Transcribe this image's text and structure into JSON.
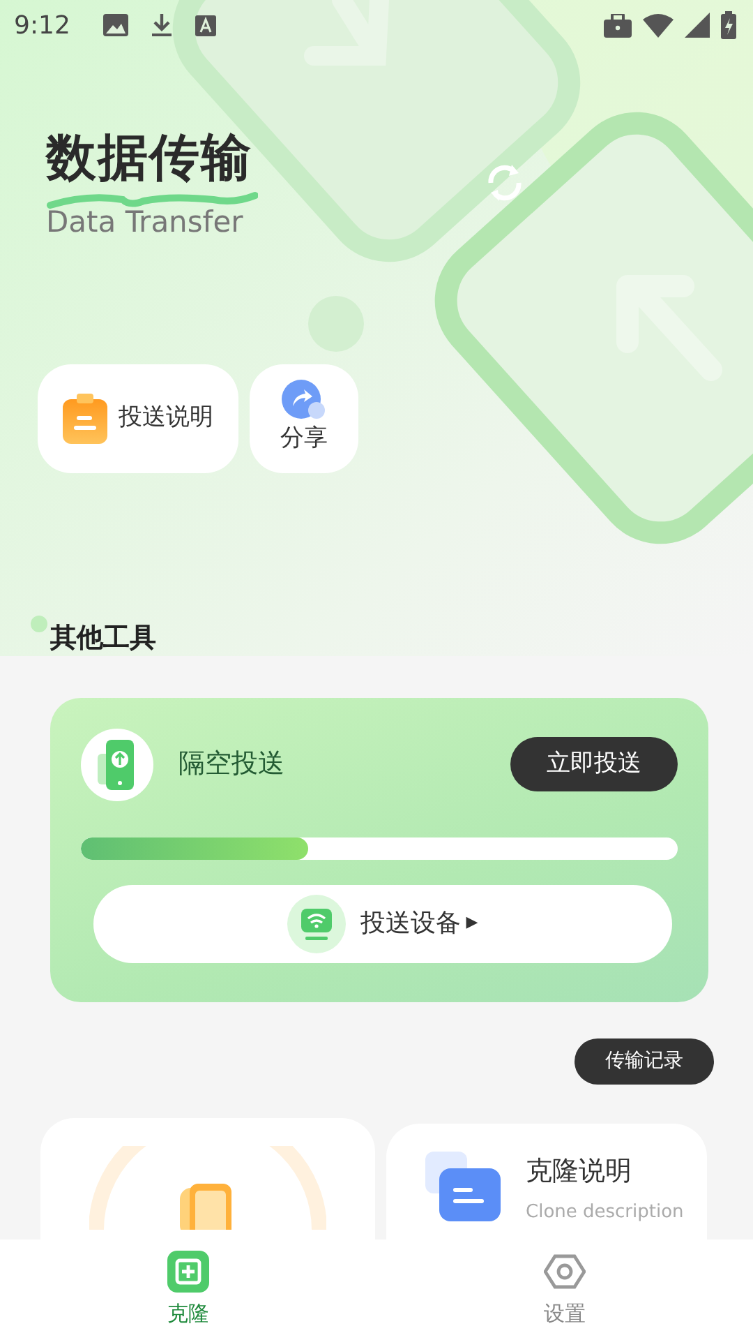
{
  "status_bar": {
    "time": "9:12"
  },
  "header": {
    "title": "数据传输",
    "subtitle": "Data Transfer"
  },
  "quick_actions": [
    {
      "label": "投送说明",
      "kind": "row"
    },
    {
      "label": "分享",
      "kind": "stacked"
    }
  ],
  "section_title": "其他工具",
  "cast_card": {
    "title": "隔空投送",
    "action": "立即投送",
    "level": 0.38,
    "device_button": "投送设备",
    "arrow": "▶"
  },
  "history_button": "传输记录",
  "clone_info": {
    "title": "克隆说明",
    "subtitle": "Clone description"
  },
  "bottom_nav": [
    {
      "label": "克隆",
      "selected": true
    },
    {
      "label": "设置",
      "selected": false
    }
  ]
}
